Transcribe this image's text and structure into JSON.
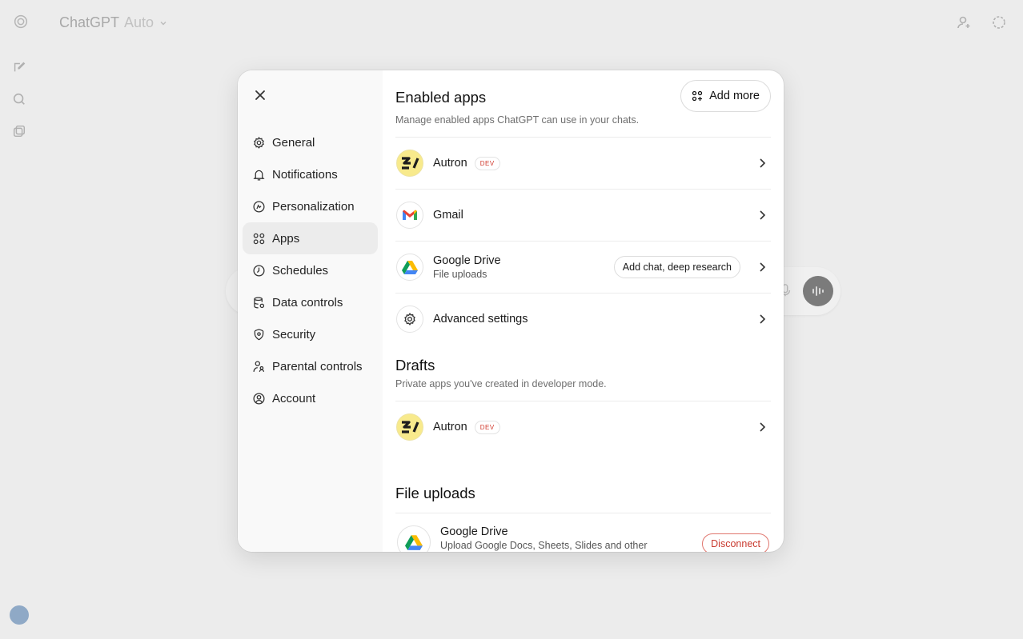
{
  "background": {
    "app_title": "ChatGPT",
    "model_label": "Auto"
  },
  "settings": {
    "nav": [
      {
        "label": "General",
        "icon": "gear-icon"
      },
      {
        "label": "Notifications",
        "icon": "bell-icon"
      },
      {
        "label": "Personalization",
        "icon": "personalization-icon"
      },
      {
        "label": "Apps",
        "icon": "apps-grid-icon",
        "active": true
      },
      {
        "label": "Schedules",
        "icon": "clock-icon"
      },
      {
        "label": "Data controls",
        "icon": "database-icon"
      },
      {
        "label": "Security",
        "icon": "shield-icon"
      },
      {
        "label": "Parental controls",
        "icon": "parental-icon"
      },
      {
        "label": "Account",
        "icon": "user-circle-icon"
      }
    ],
    "enabled_apps": {
      "title": "Enabled apps",
      "subtitle": "Manage enabled apps ChatGPT can use in your chats.",
      "add_more_label": "Add more",
      "items": [
        {
          "name": "Autron",
          "badge": "DEV"
        },
        {
          "name": "Gmail"
        },
        {
          "name": "Google Drive",
          "detail": "File uploads",
          "pill": "Add chat, deep research"
        },
        {
          "name": "Advanced settings"
        }
      ]
    },
    "drafts": {
      "title": "Drafts",
      "subtitle": "Private apps you've created in developer mode.",
      "items": [
        {
          "name": "Autron",
          "badge": "DEV"
        }
      ]
    },
    "file_uploads": {
      "title": "File uploads",
      "items": [
        {
          "name": "Google Drive",
          "detail": "Upload Google Docs, Sheets, Slides and other",
          "action": "Disconnect"
        }
      ]
    }
  },
  "colors": {
    "accent_danger": "#c93a2f",
    "autron_bg": "#f8ea8c"
  }
}
